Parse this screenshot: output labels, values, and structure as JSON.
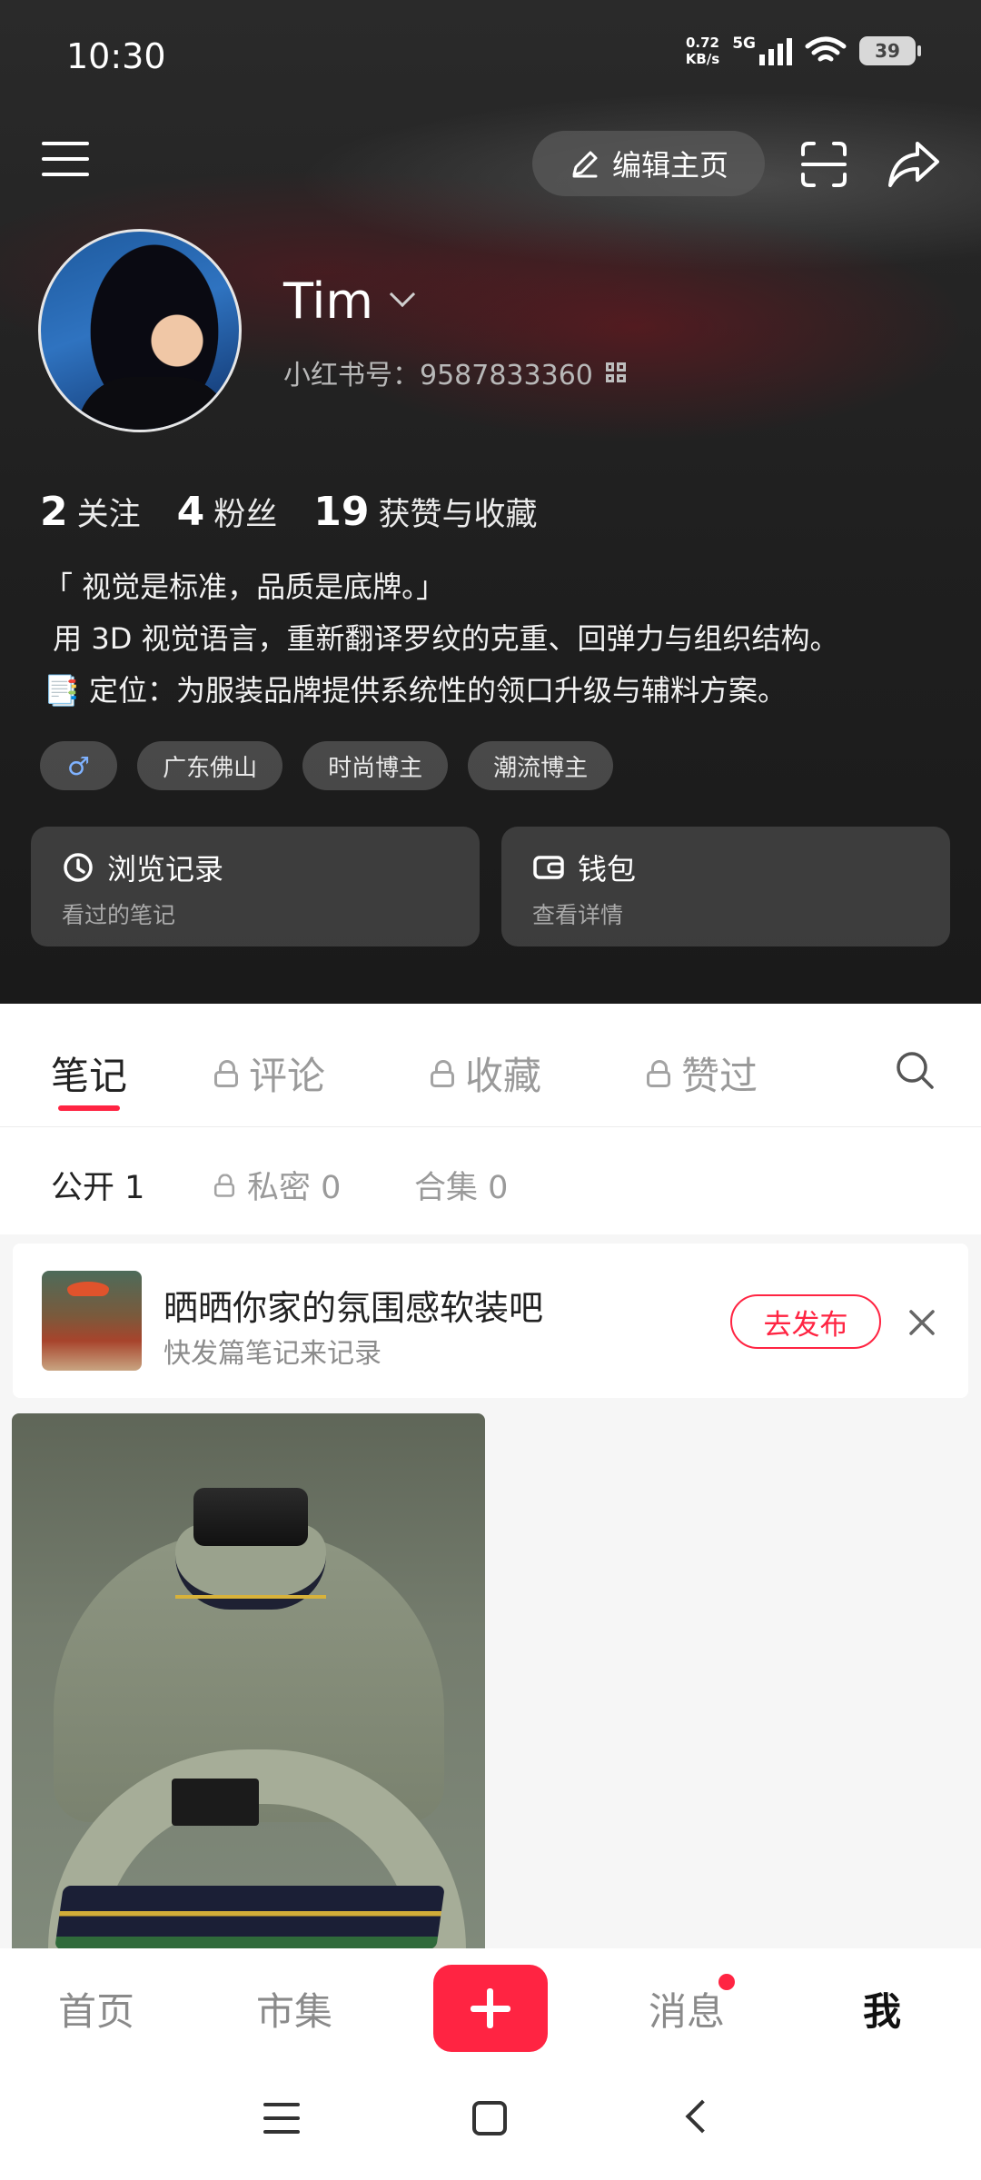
{
  "status_bar": {
    "time": "10:30",
    "net_speed_value": "0.72",
    "net_speed_unit": "KB/s",
    "network": "5G",
    "battery": "39"
  },
  "topbar": {
    "edit_label": "编辑主页"
  },
  "profile": {
    "nickname": "Tim",
    "red_id": "小红书号：9587833360",
    "stats": [
      {
        "num": "2",
        "label": "关注"
      },
      {
        "num": "4",
        "label": "粉丝"
      },
      {
        "num": "19",
        "label": "获赞与收藏"
      }
    ],
    "bio": [
      "「 视觉是标准，品质是底牌。」",
      " 用 3D 视觉语言，重新翻译罗纹的克重、回弹力与组织结构。",
      "📑 定位：为服装品牌提供系统性的领口升级与辅料方案。"
    ],
    "gender_symbol": "♂",
    "tags": [
      "广东佛山",
      "时尚博主",
      "潮流博主"
    ]
  },
  "cards": [
    {
      "title": "浏览记录",
      "subtitle": "看过的笔记",
      "icon": "clock-icon"
    },
    {
      "title": "钱包",
      "subtitle": "查看详情",
      "icon": "wallet-icon"
    }
  ],
  "tabs": [
    {
      "label": "笔记",
      "locked": false
    },
    {
      "label": "评论",
      "locked": true
    },
    {
      "label": "收藏",
      "locked": true
    },
    {
      "label": "赞过",
      "locked": true
    }
  ],
  "subtabs": [
    {
      "label": "公开 1",
      "locked": false
    },
    {
      "label": "私密 0",
      "locked": true
    },
    {
      "label": "合集 0",
      "locked": false
    }
  ],
  "promo": {
    "title": "晒晒你家的氛围感软装吧",
    "subtitle": "快发篇笔记来记录",
    "button": "去发布"
  },
  "bottom_nav": {
    "home": "首页",
    "market": "市集",
    "messages": "消息",
    "me": "我"
  },
  "colors": {
    "accent": "#ff2442",
    "header_bg": "#1f1f1f",
    "tag_blue": "#7fb2ff"
  }
}
